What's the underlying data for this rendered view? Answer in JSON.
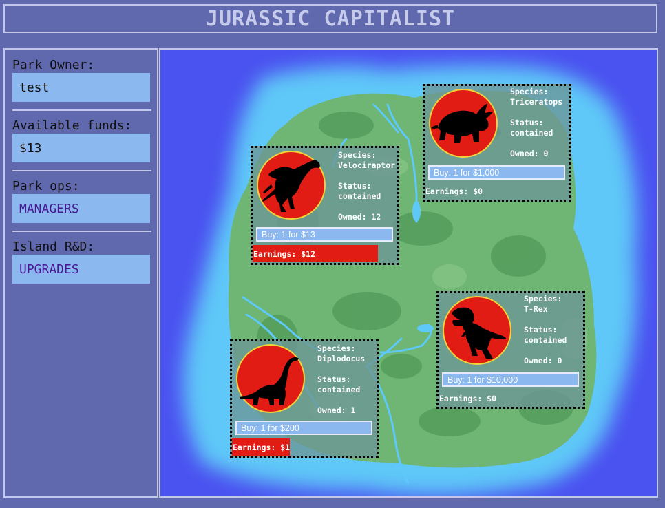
{
  "app": {
    "title": "JURASSIC CAPITALIST"
  },
  "sidebar": {
    "owner_label": "Park Owner:",
    "owner_value": "test",
    "funds_label": "Available funds:",
    "funds_value": "$13",
    "ops_label": "Park ops:",
    "ops_link": "MANAGERS",
    "rnd_label": "Island R&D:",
    "rnd_link": "UPGRADES"
  },
  "colors": {
    "background": "#6068ae",
    "ocean": "#4a52f0",
    "shallow": "#5ec8f8",
    "land": "#6fb573",
    "emblem_red": "#e01c14",
    "button_blue": "#8bb8ee",
    "link_purple": "#4b1594"
  },
  "dinos": [
    {
      "species_label": "Species:",
      "species": "Velociraptor",
      "status_label": "Status:",
      "status": "contained",
      "owned": "Owned: 12",
      "buy": "Buy: 1 for $13",
      "earnings": "Earnings: $12",
      "progress": 0.95,
      "icon": "velociraptor-silhouette-icon"
    },
    {
      "species_label": "Species:",
      "species": "Triceratops",
      "status_label": "Status:",
      "status": "contained",
      "owned": "Owned: 0",
      "buy": "Buy: 1 for $1,000",
      "earnings": "Earnings: $0",
      "progress": 0,
      "icon": "triceratops-silhouette-icon"
    },
    {
      "species_label": "Species:",
      "species": "T-Rex",
      "status_label": "Status:",
      "status": "contained",
      "owned": "Owned: 0",
      "buy": "Buy: 1 for $10,000",
      "earnings": "Earnings: $0",
      "progress": 0,
      "icon": "trex-silhouette-icon"
    },
    {
      "species_label": "Species:",
      "species": "Diplodocus",
      "status_label": "Status:",
      "status": "contained",
      "owned": "Owned: 1",
      "buy": "Buy: 1 for $200",
      "earnings": "Earnings: $1",
      "progress": 0.44,
      "icon": "diplodocus-silhouette-icon"
    }
  ]
}
